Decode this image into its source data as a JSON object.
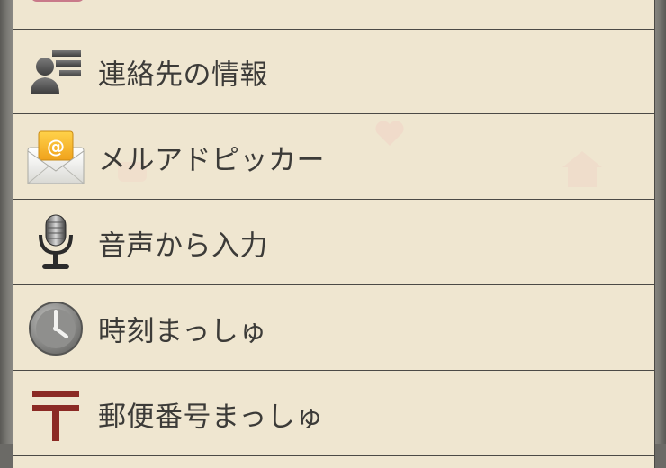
{
  "menu": {
    "items": [
      {
        "label": "",
        "icon": "card-icon"
      },
      {
        "label": "連絡先の情報",
        "icon": "contact-info-icon"
      },
      {
        "label": "メルアドピッカー",
        "icon": "email-envelope-icon"
      },
      {
        "label": "音声から入力",
        "icon": "microphone-icon"
      },
      {
        "label": "時刻まっしゅ",
        "icon": "clock-icon"
      },
      {
        "label": "郵便番号まっしゅ",
        "icon": "postal-mark-icon"
      }
    ]
  },
  "colors": {
    "row_background": "#efe6d0",
    "divider": "#4b4a46",
    "text": "#3c3b38",
    "frame": "#8a8984",
    "postal_red": "#8b2a24"
  }
}
